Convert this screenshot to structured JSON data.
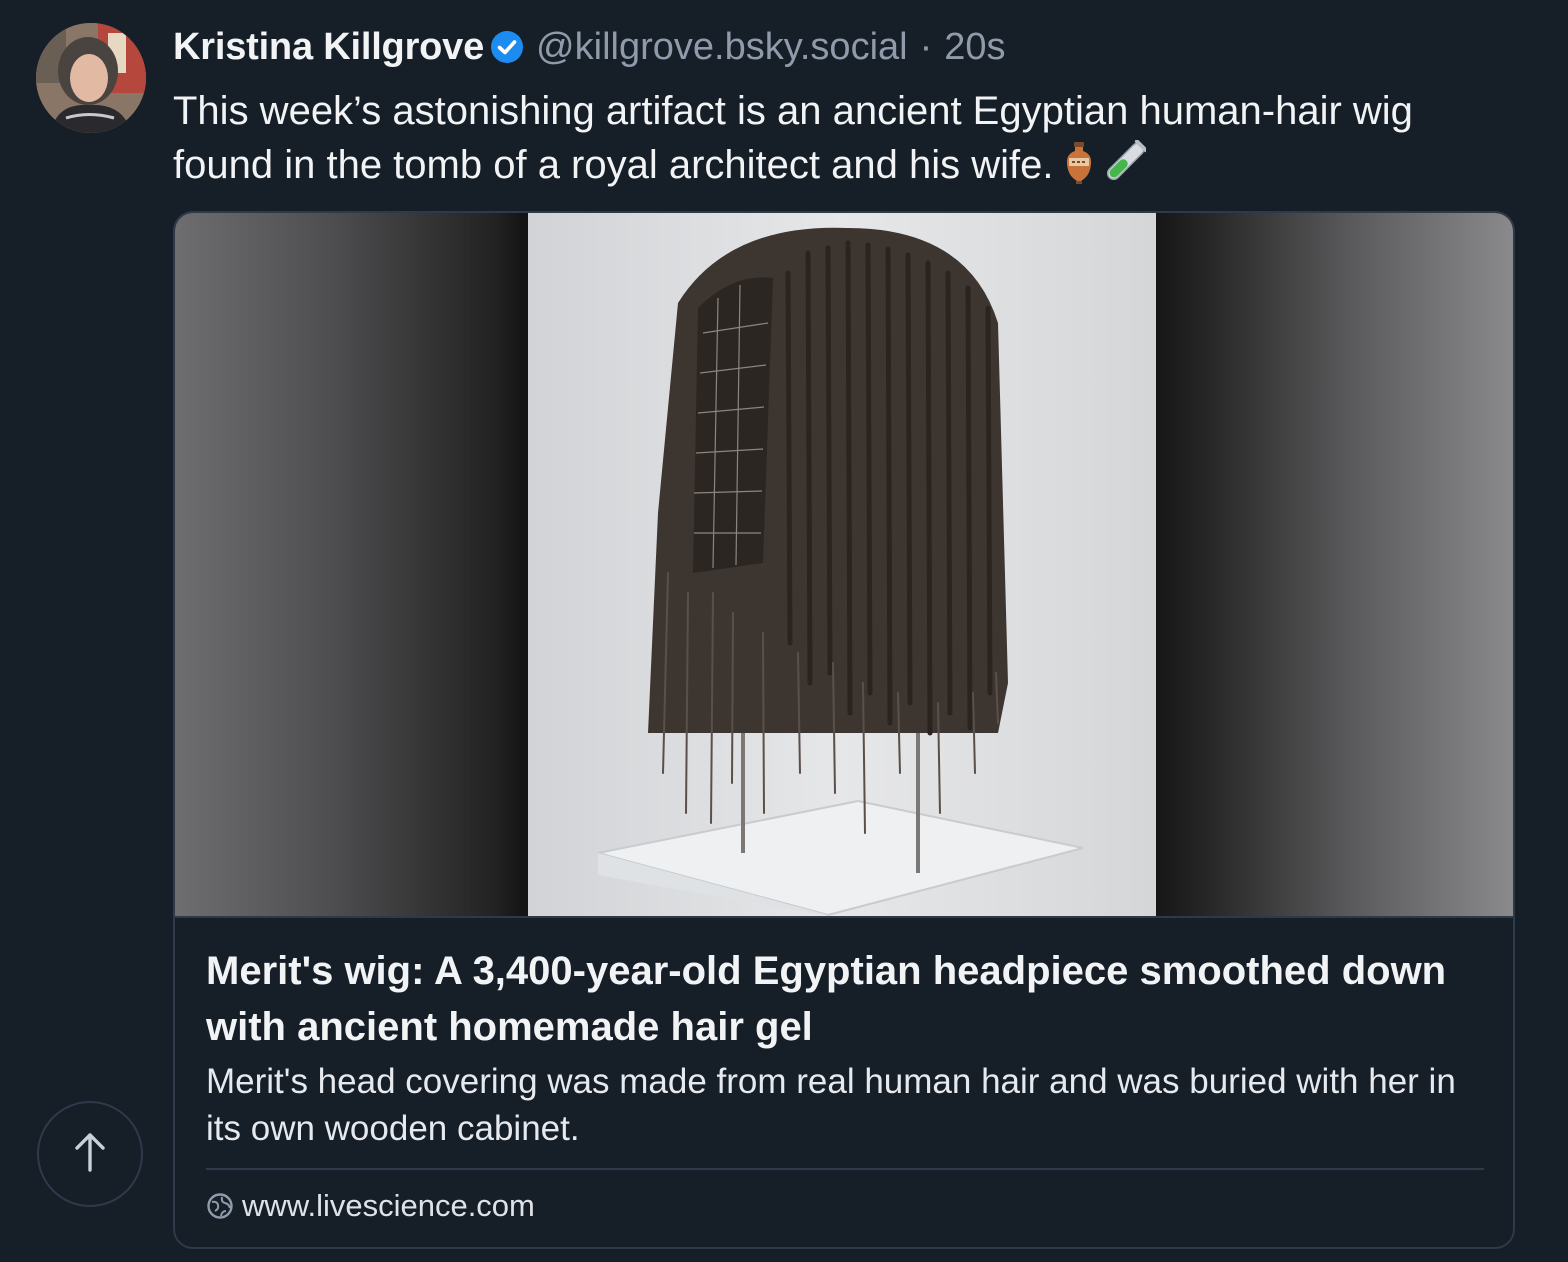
{
  "post": {
    "author": {
      "display_name": "Kristina Killgrove",
      "verified": true,
      "handle": "@killgrove.bsky.social",
      "separator": "·",
      "time": "20s"
    },
    "text": "This week’s astonishing artifact is an ancient Egyptian human-hair wig found in the tomb of a royal architect and his wife.",
    "emojis": [
      "amphora-icon",
      "test-tube-icon"
    ],
    "link_card": {
      "title": "Merit's wig: A 3,400-year-old Egyptian headpiece smoothed down with ancient homemade hair gel",
      "description": "Merit's head covering was made from real human hair and was buried with her in its own wooden cabinet.",
      "domain": "www.livescience.com"
    }
  },
  "controls": {
    "scroll_top_icon": "arrow-up-icon"
  },
  "colors": {
    "background": "#161e27",
    "border": "#2e3a4a",
    "verified": "#1d8cf0",
    "muted_text": "#8f9bab"
  }
}
